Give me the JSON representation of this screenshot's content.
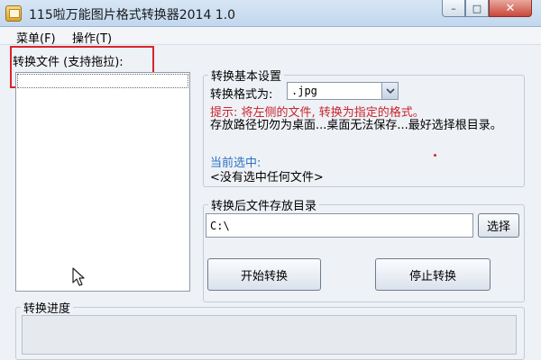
{
  "window": {
    "title": "115啦万能图片格式转换器2014 1.0",
    "controls": {
      "minimize": "–",
      "maximize": "□",
      "close": "✕"
    }
  },
  "menu": {
    "file": "菜单(F)",
    "operations": "操作(T)"
  },
  "files_panel": {
    "label": "转换文件 (支持拖拉):",
    "items": []
  },
  "basic_settings": {
    "legend": "转换基本设置",
    "format_label": "转换格式为:",
    "format_value": ".jpg",
    "tip": "提示: 将左侧的文件, 转换为指定的格式。",
    "path_note": "存放路径切勿为桌面...桌面无法保存...最好选择根目录。",
    "current_label": "当前选中:",
    "current_value": "<没有选中任何文件>"
  },
  "output_dir": {
    "legend": "转换后文件存放目录",
    "value": "C:\\",
    "browse_label": "选择"
  },
  "actions": {
    "start_label": "开始转换",
    "stop_label": "停止转换"
  },
  "progress": {
    "legend": "转换进度",
    "value": 0
  },
  "icons": {
    "app": "app-icon",
    "format_dropdown": "chevron-down-icon",
    "cursor": "mouse-cursor-icon"
  },
  "colors": {
    "titlebar": "#c2d7ee",
    "tip_text": "#c8252c",
    "current_label": "#2b72c2",
    "highlight_border": "#d9242b"
  }
}
